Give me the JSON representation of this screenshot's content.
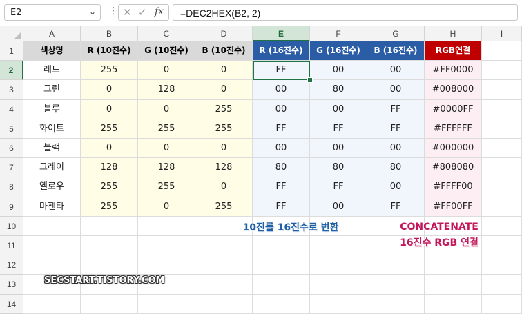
{
  "formula_bar": {
    "name_box": "E2",
    "name_box_icon": "chevron-down-icon",
    "more_icon": "vertical-dots-icon",
    "cancel_icon": "close-icon",
    "enter_icon": "check-icon",
    "fx_label": "fx",
    "formula": "=DEC2HEX(B2, 2)"
  },
  "columns": [
    "A",
    "B",
    "C",
    "D",
    "E",
    "F",
    "G",
    "H",
    "I"
  ],
  "selected_column": "E",
  "rows": [
    "1",
    "2",
    "3",
    "4",
    "5",
    "6",
    "7",
    "8",
    "9",
    "10",
    "11",
    "12",
    "13",
    "14"
  ],
  "selected_row": "2",
  "table": {
    "headers": [
      "색상명",
      "R (10진수)",
      "G (10진수)",
      "B (10진수)",
      "R (16진수)",
      "G (16진수)",
      "B (16진수)",
      "RGB연결"
    ],
    "data": [
      [
        "레드",
        "255",
        "0",
        "0",
        "FF",
        "00",
        "00",
        "#FF0000"
      ],
      [
        "그린",
        "0",
        "128",
        "0",
        "00",
        "80",
        "00",
        "#008000"
      ],
      [
        "블루",
        "0",
        "0",
        "255",
        "00",
        "00",
        "FF",
        "#0000FF"
      ],
      [
        "화이트",
        "255",
        "255",
        "255",
        "FF",
        "FF",
        "FF",
        "#FFFFFF"
      ],
      [
        "블랙",
        "0",
        "0",
        "0",
        "00",
        "00",
        "00",
        "#000000"
      ],
      [
        "그레이",
        "128",
        "128",
        "128",
        "80",
        "80",
        "80",
        "#808080"
      ],
      [
        "옐로우",
        "255",
        "255",
        "0",
        "FF",
        "FF",
        "00",
        "#FFFF00"
      ],
      [
        "마젠타",
        "255",
        "0",
        "255",
        "FF",
        "00",
        "FF",
        "#FF00FF"
      ]
    ]
  },
  "annotations": {
    "hex_note": "10진를 16진수로 변환",
    "concat_line1": "CONCATENATE",
    "concat_line2": "16진수 RGB 연결"
  },
  "watermark": "SECSTART.TISTORY.COM",
  "colors": {
    "header_gray": "#d9d9d9",
    "header_blue": "#2a5da6",
    "header_red": "#c00000",
    "decimal_fill": "#fffde6",
    "hex_fill": "#f1f6fc",
    "rgb_fill": "#fdeef3",
    "selection": "#217346"
  }
}
